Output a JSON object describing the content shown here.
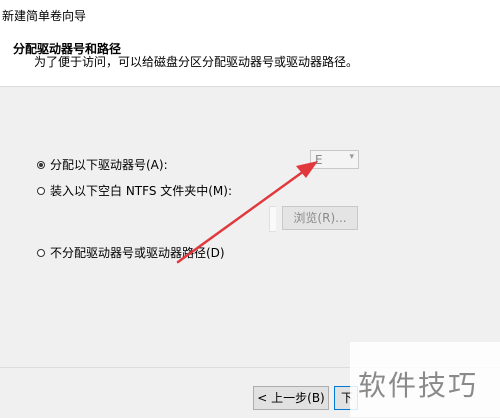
{
  "window": {
    "title": "新建简单卷向导"
  },
  "header": {
    "title": "分配驱动器号和路径",
    "subtitle": "为了便于访问，可以给磁盘分区分配驱动器号或驱动器路径。"
  },
  "options": {
    "assign_letter": {
      "label": "分配以下驱动器号(A):",
      "selected": true
    },
    "mount_folder": {
      "label": "装入以下空白 NTFS 文件夹中(M):",
      "selected": false
    },
    "no_assign": {
      "label": "不分配驱动器号或驱动器路径(D)",
      "selected": false
    }
  },
  "drive_letter_select": {
    "value": "E"
  },
  "browse_button": {
    "label": "浏览(R)..."
  },
  "footer": {
    "back_label": "< 上一步(B)",
    "next_label": "下"
  },
  "watermark": {
    "text": "软件技巧"
  },
  "colors": {
    "annotation_arrow": "#e0383c"
  }
}
